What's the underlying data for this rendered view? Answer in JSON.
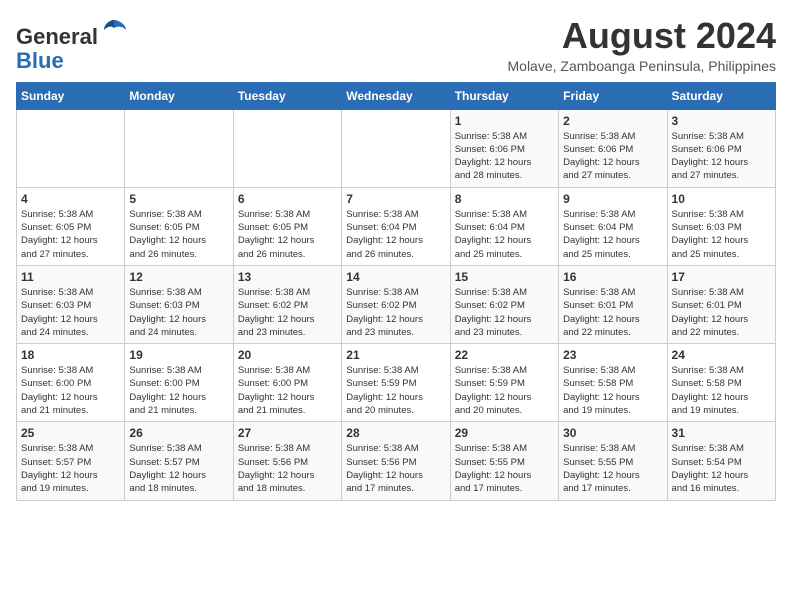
{
  "header": {
    "logo_general": "General",
    "logo_blue": "Blue",
    "title": "August 2024",
    "subtitle": "Molave, Zamboanga Peninsula, Philippines"
  },
  "days_of_week": [
    "Sunday",
    "Monday",
    "Tuesday",
    "Wednesday",
    "Thursday",
    "Friday",
    "Saturday"
  ],
  "weeks": [
    [
      {
        "day": "",
        "info": ""
      },
      {
        "day": "",
        "info": ""
      },
      {
        "day": "",
        "info": ""
      },
      {
        "day": "",
        "info": ""
      },
      {
        "day": "1",
        "sunrise": "5:38 AM",
        "sunset": "6:06 PM",
        "daylight": "12 hours and 28 minutes."
      },
      {
        "day": "2",
        "sunrise": "5:38 AM",
        "sunset": "6:06 PM",
        "daylight": "12 hours and 27 minutes."
      },
      {
        "day": "3",
        "sunrise": "5:38 AM",
        "sunset": "6:06 PM",
        "daylight": "12 hours and 27 minutes."
      }
    ],
    [
      {
        "day": "4",
        "sunrise": "5:38 AM",
        "sunset": "6:05 PM",
        "daylight": "12 hours and 27 minutes."
      },
      {
        "day": "5",
        "sunrise": "5:38 AM",
        "sunset": "6:05 PM",
        "daylight": "12 hours and 26 minutes."
      },
      {
        "day": "6",
        "sunrise": "5:38 AM",
        "sunset": "6:05 PM",
        "daylight": "12 hours and 26 minutes."
      },
      {
        "day": "7",
        "sunrise": "5:38 AM",
        "sunset": "6:04 PM",
        "daylight": "12 hours and 26 minutes."
      },
      {
        "day": "8",
        "sunrise": "5:38 AM",
        "sunset": "6:04 PM",
        "daylight": "12 hours and 25 minutes."
      },
      {
        "day": "9",
        "sunrise": "5:38 AM",
        "sunset": "6:04 PM",
        "daylight": "12 hours and 25 minutes."
      },
      {
        "day": "10",
        "sunrise": "5:38 AM",
        "sunset": "6:03 PM",
        "daylight": "12 hours and 25 minutes."
      }
    ],
    [
      {
        "day": "11",
        "sunrise": "5:38 AM",
        "sunset": "6:03 PM",
        "daylight": "12 hours and 24 minutes."
      },
      {
        "day": "12",
        "sunrise": "5:38 AM",
        "sunset": "6:03 PM",
        "daylight": "12 hours and 24 minutes."
      },
      {
        "day": "13",
        "sunrise": "5:38 AM",
        "sunset": "6:02 PM",
        "daylight": "12 hours and 23 minutes."
      },
      {
        "day": "14",
        "sunrise": "5:38 AM",
        "sunset": "6:02 PM",
        "daylight": "12 hours and 23 minutes."
      },
      {
        "day": "15",
        "sunrise": "5:38 AM",
        "sunset": "6:02 PM",
        "daylight": "12 hours and 23 minutes."
      },
      {
        "day": "16",
        "sunrise": "5:38 AM",
        "sunset": "6:01 PM",
        "daylight": "12 hours and 22 minutes."
      },
      {
        "day": "17",
        "sunrise": "5:38 AM",
        "sunset": "6:01 PM",
        "daylight": "12 hours and 22 minutes."
      }
    ],
    [
      {
        "day": "18",
        "sunrise": "5:38 AM",
        "sunset": "6:00 PM",
        "daylight": "12 hours and 21 minutes."
      },
      {
        "day": "19",
        "sunrise": "5:38 AM",
        "sunset": "6:00 PM",
        "daylight": "12 hours and 21 minutes."
      },
      {
        "day": "20",
        "sunrise": "5:38 AM",
        "sunset": "6:00 PM",
        "daylight": "12 hours and 21 minutes."
      },
      {
        "day": "21",
        "sunrise": "5:38 AM",
        "sunset": "5:59 PM",
        "daylight": "12 hours and 20 minutes."
      },
      {
        "day": "22",
        "sunrise": "5:38 AM",
        "sunset": "5:59 PM",
        "daylight": "12 hours and 20 minutes."
      },
      {
        "day": "23",
        "sunrise": "5:38 AM",
        "sunset": "5:58 PM",
        "daylight": "12 hours and 19 minutes."
      },
      {
        "day": "24",
        "sunrise": "5:38 AM",
        "sunset": "5:58 PM",
        "daylight": "12 hours and 19 minutes."
      }
    ],
    [
      {
        "day": "25",
        "sunrise": "5:38 AM",
        "sunset": "5:57 PM",
        "daylight": "12 hours and 19 minutes."
      },
      {
        "day": "26",
        "sunrise": "5:38 AM",
        "sunset": "5:57 PM",
        "daylight": "12 hours and 18 minutes."
      },
      {
        "day": "27",
        "sunrise": "5:38 AM",
        "sunset": "5:56 PM",
        "daylight": "12 hours and 18 minutes."
      },
      {
        "day": "28",
        "sunrise": "5:38 AM",
        "sunset": "5:56 PM",
        "daylight": "12 hours and 17 minutes."
      },
      {
        "day": "29",
        "sunrise": "5:38 AM",
        "sunset": "5:55 PM",
        "daylight": "12 hours and 17 minutes."
      },
      {
        "day": "30",
        "sunrise": "5:38 AM",
        "sunset": "5:55 PM",
        "daylight": "12 hours and 17 minutes."
      },
      {
        "day": "31",
        "sunrise": "5:38 AM",
        "sunset": "5:54 PM",
        "daylight": "12 hours and 16 minutes."
      }
    ]
  ],
  "labels": {
    "sunrise_prefix": "Sunrise: ",
    "sunset_prefix": "Sunset: ",
    "daylight_prefix": "Daylight: "
  }
}
